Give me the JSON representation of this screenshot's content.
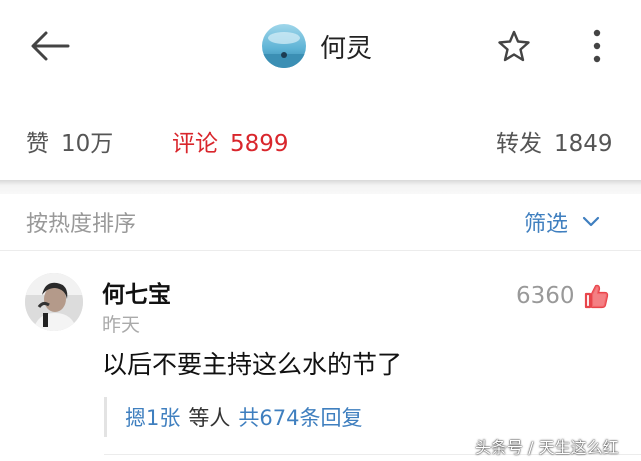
{
  "header": {
    "title": "何灵",
    "back_icon": "arrow-left-icon",
    "favorite_icon": "star-icon",
    "more_icon": "more-vertical-icon"
  },
  "stats": {
    "likes_label": "赞",
    "likes_value": "10万",
    "comments_label": "评论",
    "comments_value": "5899",
    "reposts_label": "转发",
    "reposts_value": "1849",
    "active_color": "#d9262c"
  },
  "sort": {
    "label": "按热度排序",
    "filter_label": "筛选",
    "filter_icon": "chevron-down-icon",
    "filter_color": "#3f7fbf"
  },
  "comment": {
    "author": "何七宝",
    "time": "昨天",
    "likes": "6360",
    "like_icon": "thumbs-up-icon",
    "text": "以后不要主持这么水的节了",
    "reply": {
      "user": "摁1张",
      "middle": "等人",
      "total": "共674条回复"
    }
  },
  "watermark": "头条号 / 天生这么红"
}
